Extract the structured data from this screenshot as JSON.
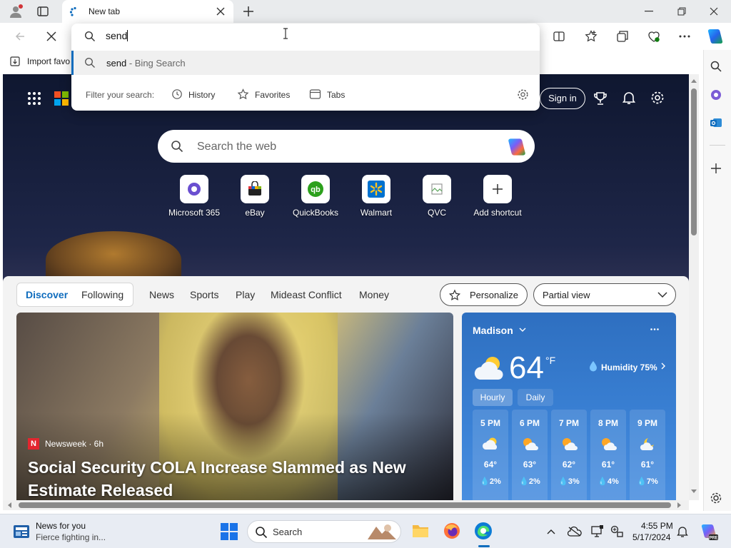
{
  "browser": {
    "tab_title": "New tab",
    "favorites_import": "Import favo"
  },
  "omnibox": {
    "typed": "send",
    "suggestion_query": "send",
    "suggestion_suffix": " - Bing Search",
    "filter_label": "Filter your search:",
    "filters": [
      "History",
      "Favorites",
      "Tabs"
    ]
  },
  "ntp": {
    "sign_in": "Sign in",
    "search_placeholder": "Search the web",
    "shortcuts": [
      "Microsoft 365",
      "eBay",
      "QuickBooks",
      "Walmart",
      "QVC",
      "Add shortcut"
    ],
    "feed_tabs": [
      "Discover",
      "Following",
      "News",
      "Sports",
      "Play",
      "Mideast Conflict",
      "Money"
    ],
    "personalize": "Personalize",
    "view_mode": "Partial view"
  },
  "news": {
    "source": "Newsweek · 6h",
    "headline": "Social Security COLA Increase Slammed as New Estimate Released"
  },
  "weather": {
    "location": "Madison",
    "temperature": "64",
    "unit": "°F",
    "humidity": "Humidity 75%",
    "tab_hourly": "Hourly",
    "tab_daily": "Daily",
    "hours": [
      {
        "time": "5 PM",
        "temp": "64°",
        "precip": "2%"
      },
      {
        "time": "6 PM",
        "temp": "63°",
        "precip": "2%"
      },
      {
        "time": "7 PM",
        "temp": "62°",
        "precip": "3%"
      },
      {
        "time": "8 PM",
        "temp": "61°",
        "precip": "4%"
      },
      {
        "time": "9 PM",
        "temp": "61°",
        "precip": "7%"
      }
    ]
  },
  "taskbar": {
    "news_title": "News for you",
    "news_sub": "Fierce fighting in...",
    "search_label": "Search",
    "time": "4:55 PM",
    "date": "5/17/2024"
  },
  "colors": {
    "accent": "#0f6cbd",
    "weather_bg": "#3b82d6",
    "taskbar_bg": "#e8ecf3"
  }
}
